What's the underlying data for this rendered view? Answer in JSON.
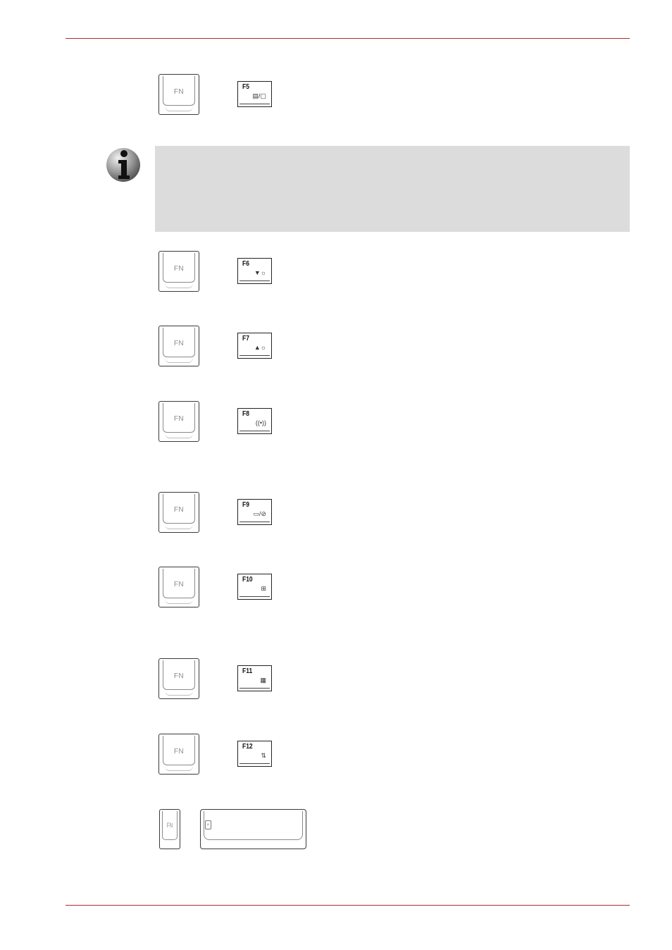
{
  "keys": {
    "fn_label": "FN",
    "rows": [
      {
        "fkey": "F5",
        "icon": "display-switch-icon",
        "glyph": "▤/▢"
      },
      {
        "fkey": "F6",
        "icon": "brightness-down-icon",
        "glyph": "▼☼"
      },
      {
        "fkey": "F7",
        "icon": "brightness-up-icon",
        "glyph": "▲☼"
      },
      {
        "fkey": "F8",
        "icon": "wireless-icon",
        "glyph": "((•))"
      },
      {
        "fkey": "F9",
        "icon": "touchpad-toggle-icon",
        "glyph": "▭/⊘"
      },
      {
        "fkey": "F10",
        "icon": "arrow-mode-icon",
        "glyph": "⊞"
      },
      {
        "fkey": "F11",
        "icon": "numeric-mode-icon",
        "glyph": "▦"
      },
      {
        "fkey": "F12",
        "icon": "scroll-lock-icon",
        "glyph": "⇅"
      }
    ],
    "space_glyph": "⌕"
  },
  "colors": {
    "rule": "#b02a30",
    "note_background": "#dcdcdc"
  }
}
